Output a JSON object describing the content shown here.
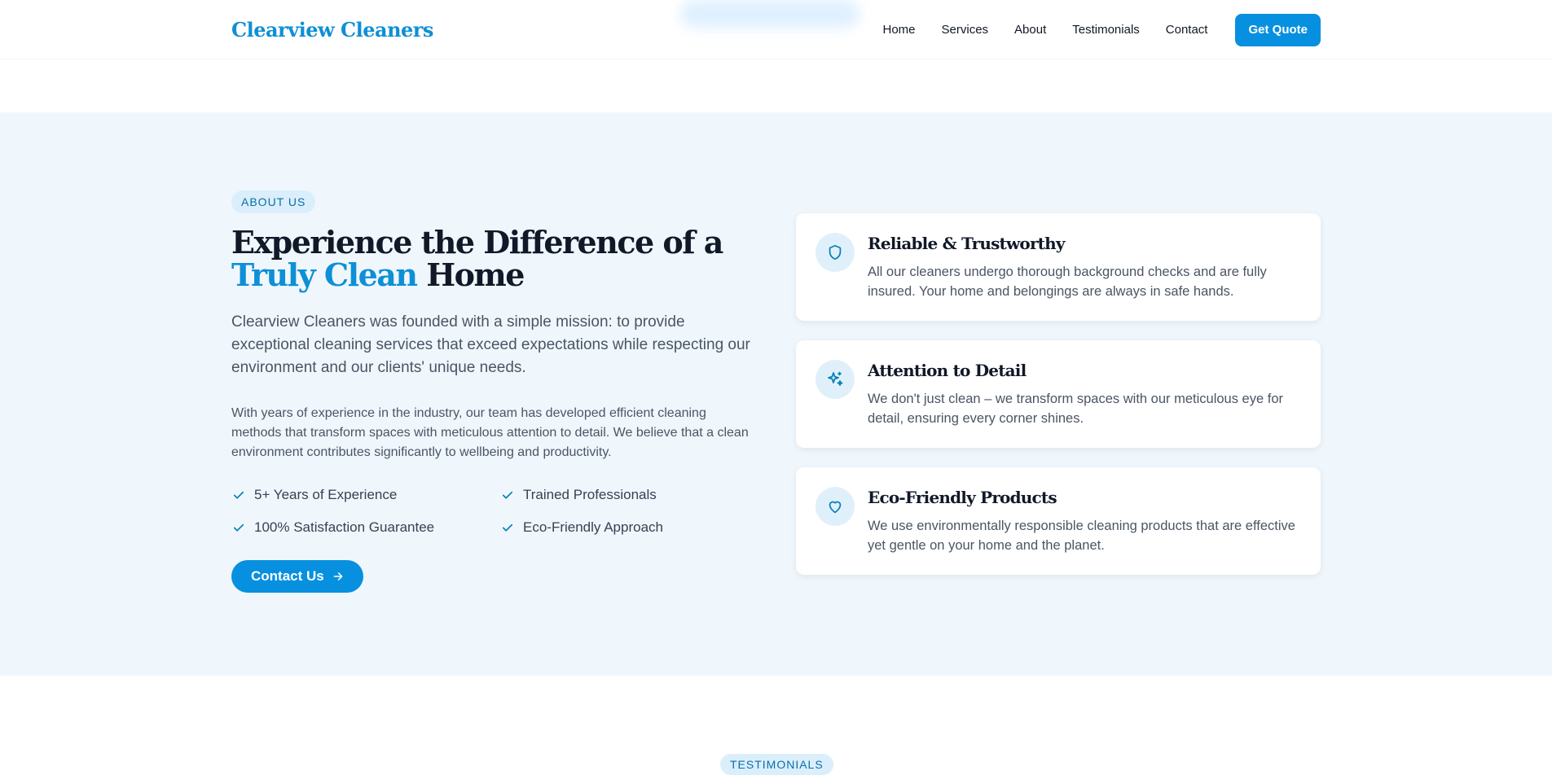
{
  "nav": {
    "logo": "Clearview Cleaners",
    "links": [
      "Home",
      "Services",
      "About",
      "Testimonials",
      "Contact"
    ],
    "cta": "Get Quote"
  },
  "about": {
    "badge": "ABOUT US",
    "headline_part1": "Experience the Difference of a ",
    "headline_accent": "Truly Clean",
    "headline_part2": " Home",
    "lead": "Clearview Cleaners was founded with a simple mission: to provide exceptional cleaning services that exceed expectations while respecting our environment and our clients' unique needs.",
    "body": "With years of experience in the industry, our team has developed efficient cleaning methods that transform spaces with meticulous attention to detail. We believe that a clean environment contributes significantly to wellbeing and productivity.",
    "features": [
      "5+ Years of Experience",
      "Trained Professionals",
      "100% Satisfaction Guarantee",
      "Eco-Friendly Approach"
    ],
    "cta": "Contact Us"
  },
  "cards": [
    {
      "title": "Reliable & Trustworthy",
      "desc": "All our cleaners undergo thorough background checks and are fully insured. Your home and belongings are always in safe hands.",
      "icon": "shield-icon"
    },
    {
      "title": "Attention to Detail",
      "desc": "We don't just clean – we transform spaces with our meticulous eye for detail, ensuring every corner shines.",
      "icon": "sparkles-icon"
    },
    {
      "title": "Eco-Friendly Products",
      "desc": "We use environmentally responsible cleaning products that are effective yet gentle on your home and the planet.",
      "icon": "heart-icon"
    }
  ],
  "testimonials": {
    "badge": "TESTIMONIALS"
  },
  "colors": {
    "accent": "#0790df",
    "section_bg": "#eff7fd",
    "badge_bg": "#dbeefb"
  }
}
